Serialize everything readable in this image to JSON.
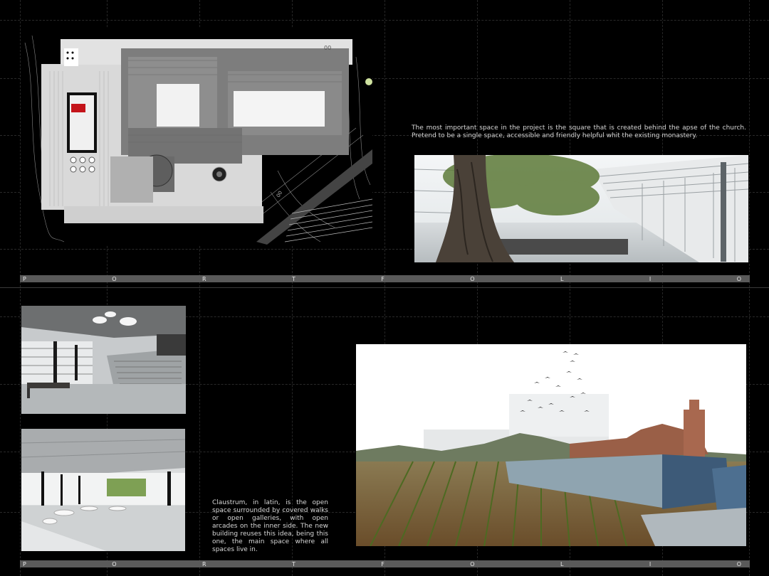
{
  "texts": {
    "square": "The most important space  in the project is the square that is created behind the apse of the church. Pretend to be a single space, accessible and friendly helpful whit the existing monastery.",
    "claustrum": "Claustrum, in latin, is the open space surrounded by covered walks or open galleries, with open arcades on the inner side. The new building reuses this idea, being this one, the main space where all spaces live in."
  },
  "plan_labels": {
    "label_a": "00",
    "label_b": "00"
  },
  "band_letters": [
    "P",
    "O",
    "R",
    "T",
    "F",
    "O",
    "L",
    "I",
    "O"
  ],
  "colors": {
    "background": "#000000",
    "band": "#5a5a5a",
    "band_text": "#e6e6e6",
    "accent_red": "#c4141a"
  }
}
